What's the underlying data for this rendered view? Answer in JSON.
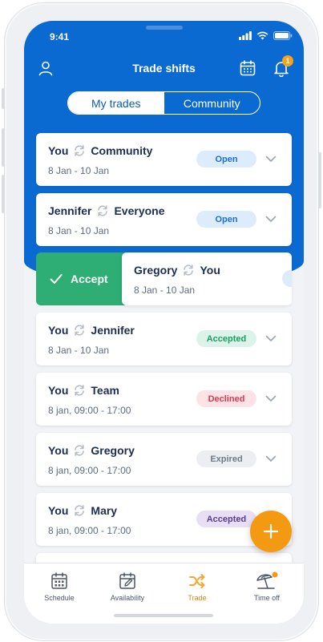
{
  "status_bar": {
    "time": "9:41"
  },
  "header": {
    "title": "Trade shifts",
    "notification_count": "1"
  },
  "tabs": [
    {
      "label": "My trades",
      "active": true
    },
    {
      "label": "Community",
      "active": false
    }
  ],
  "trades": [
    {
      "from": "You",
      "to": "Community",
      "date": "8 Jan - 10 Jan",
      "status": "Open"
    },
    {
      "from": "Jennifer",
      "to": "Everyone",
      "date": "8 Jan - 10 Jan",
      "status": "Open"
    },
    {
      "from": "You",
      "to": "Jennifer",
      "date": "8 Jan - 10 Jan",
      "status": "Accepted"
    },
    {
      "from": "You",
      "to": "Team",
      "date": "8 jan, 09:00 - 17:00",
      "status": "Declined"
    },
    {
      "from": "You",
      "to": "Gregory",
      "date": "8 jan, 09:00 - 17:00",
      "status": "Expired"
    },
    {
      "from": "You",
      "to": "Mary",
      "date": "8 jan, 09:00 - 17:00",
      "status": "Accepted"
    }
  ],
  "swiped_trade": {
    "from": "Gregory",
    "to": "You",
    "date": "8 Jan - 10 Jan",
    "action_label": "Accept"
  },
  "nav": [
    {
      "label": "Schedule",
      "icon": "calendar-grid-icon"
    },
    {
      "label": "Availability",
      "icon": "calendar-edit-icon"
    },
    {
      "label": "Trade",
      "icon": "shuffle-icon",
      "active": true
    },
    {
      "label": "Time off",
      "icon": "beach-umbrella-icon"
    }
  ],
  "colors": {
    "primary_blue": "#0a6ad2",
    "accent_orange": "#f49a12",
    "accept_green": "#2eae75",
    "text_dark": "#1a2d52"
  }
}
